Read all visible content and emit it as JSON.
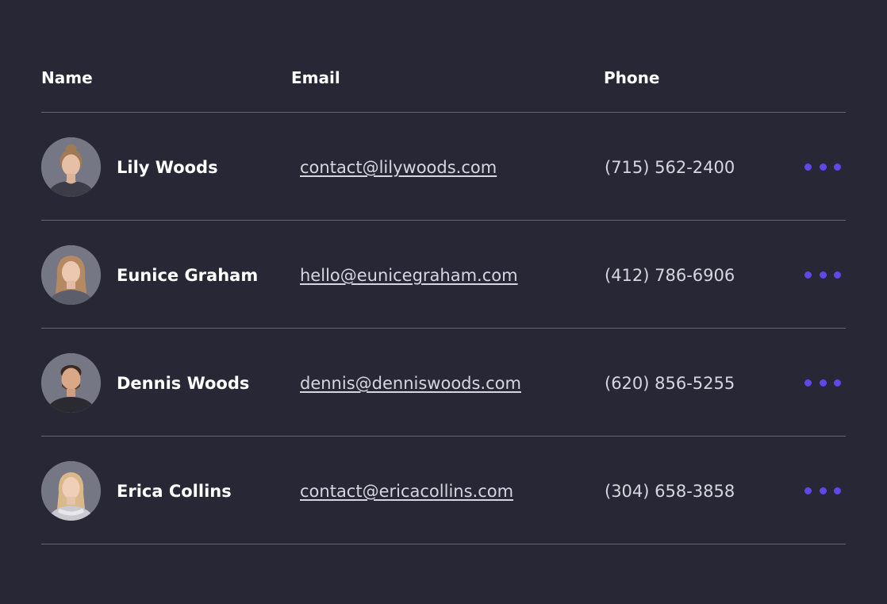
{
  "table": {
    "headers": {
      "name": "Name",
      "email": "Email",
      "phone": "Phone"
    },
    "rows": [
      {
        "name": "Lily Woods",
        "email": "contact@lilywoods.com",
        "phone": "(715) 562-2400",
        "avatar_icon": "person-avatar-icon"
      },
      {
        "name": "Eunice Graham",
        "email": "hello@eunicegraham.com",
        "phone": "(412) 786-6906",
        "avatar_icon": "person-avatar-icon"
      },
      {
        "name": "Dennis Woods",
        "email": "dennis@denniswoods.com",
        "phone": "(620) 856-5255",
        "avatar_icon": "person-avatar-icon"
      },
      {
        "name": "Erica Collins",
        "email": "contact@ericacollins.com",
        "phone": "(304) 658-3858",
        "avatar_icon": "person-avatar-icon"
      }
    ],
    "more_icon": "more-horizontal-icon"
  },
  "colors": {
    "background": "#282736",
    "divider": "#64636e",
    "accent": "#6246ea",
    "text_primary": "#ffffff",
    "text_secondary": "#d7d6df",
    "avatar_bg": "#767785"
  }
}
